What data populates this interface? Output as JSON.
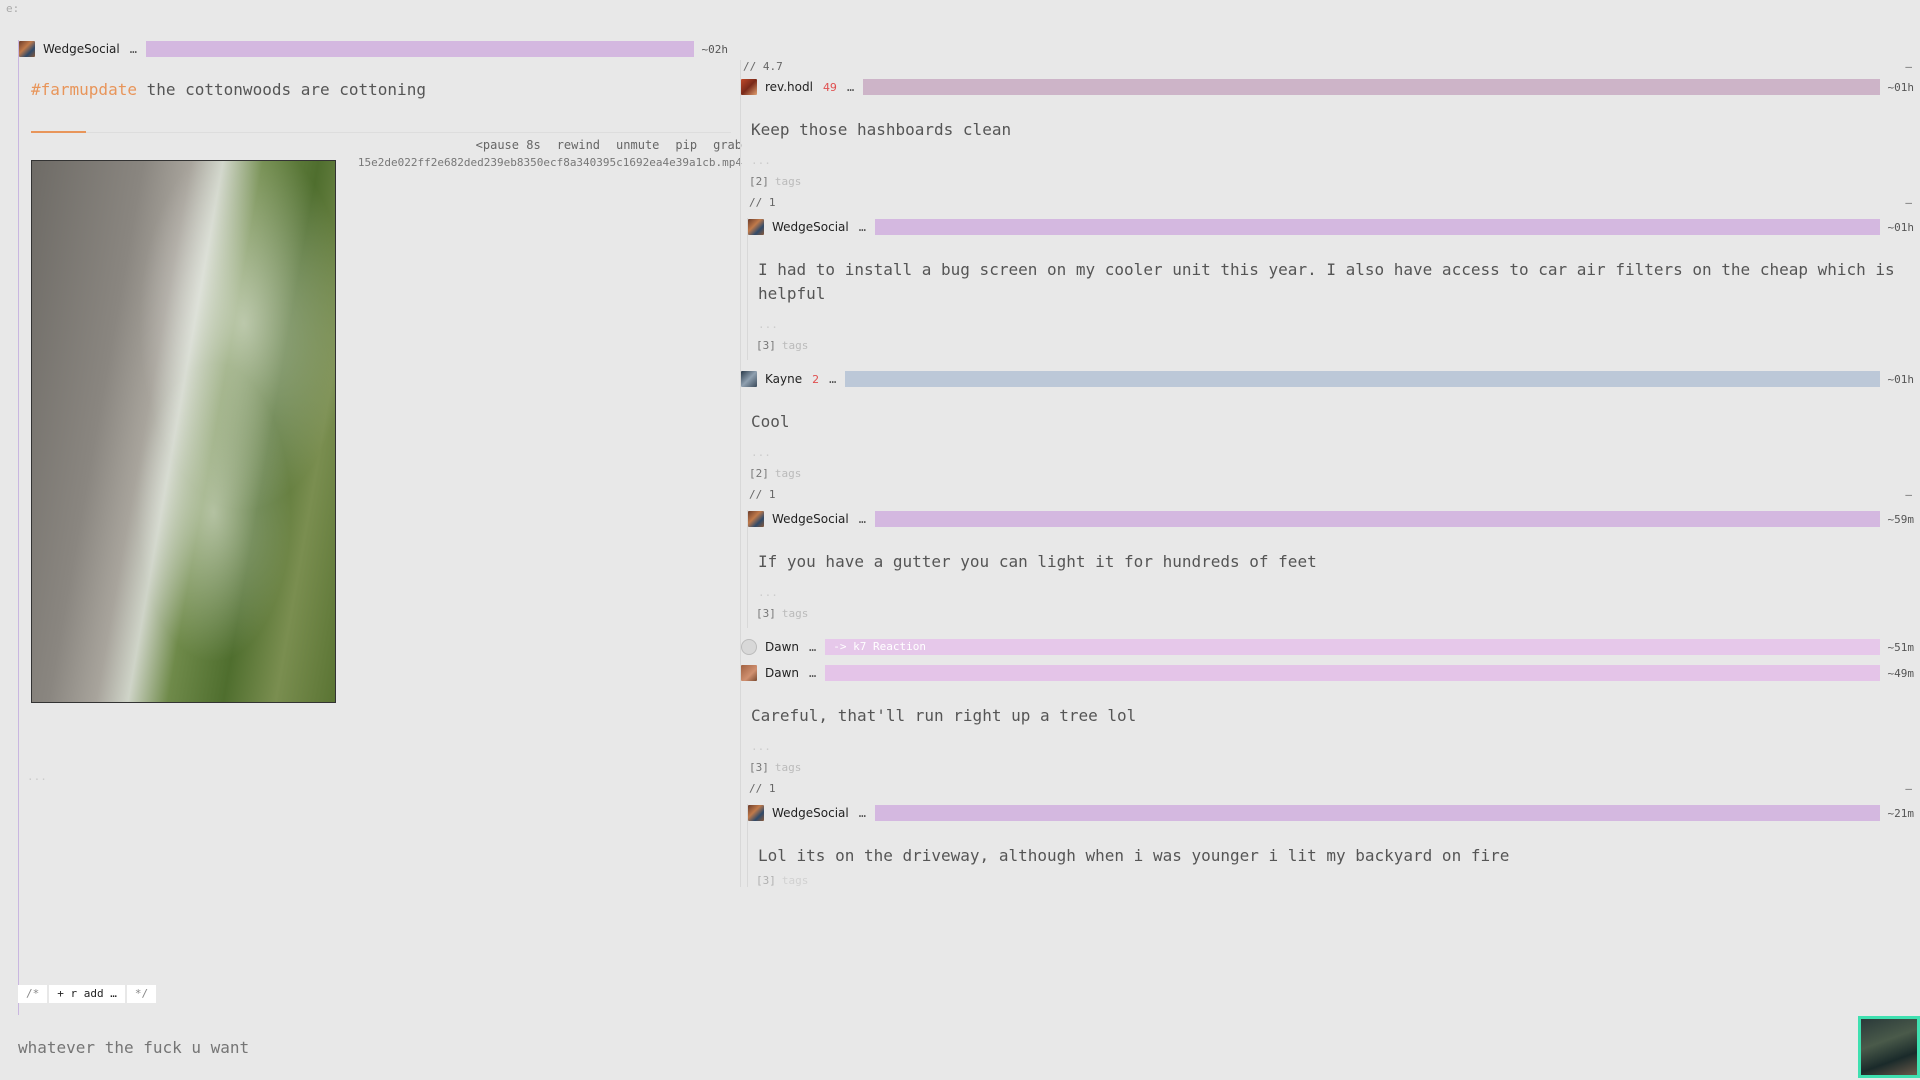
{
  "corner_label": "e:",
  "left_post": {
    "author": "WedgeSocial",
    "more": "…",
    "time": "~02h",
    "hashtag": "#farmupdate",
    "title_rest": " the cottonwoods are cottoning",
    "controls": [
      "<pause 8s",
      "rewind",
      "unmute",
      "pip",
      "grab"
    ],
    "filename": "15e2de022ff2e682ded239eb8350ecf8a340395c1692ea4e39a1cb.mp4",
    "dots": "..."
  },
  "composer": {
    "open": "/*",
    "add": "+ r add …",
    "close": "*/",
    "placeholder": "whatever the fuck u want"
  },
  "thread": {
    "top_meta": {
      "left": "// 4.7",
      "right": "–"
    },
    "posts": [
      {
        "author": "rev.hodl",
        "count": "49",
        "more": "…",
        "time": "~01h",
        "body": "Keep those hashboards clean",
        "dots": "...",
        "tags_count": "[2]",
        "tags_word": "tags",
        "meta": {
          "left": "// 1",
          "right": "–"
        },
        "reply": {
          "author": "WedgeSocial",
          "more": "…",
          "time": "~01h",
          "body": "I had to install a bug screen on my cooler unit this year. I also have access to car air filters on the cheap which is helpful",
          "dots": "...",
          "tags_count": "[3]",
          "tags_word": "tags"
        }
      },
      {
        "author": "Kayne",
        "count": "2",
        "more": "…",
        "time": "~01h",
        "body": "Cool",
        "dots": "...",
        "tags_count": "[2]",
        "tags_word": "tags",
        "meta": {
          "left": "// 1",
          "right": "–"
        },
        "reply": {
          "author": "WedgeSocial",
          "more": "…",
          "time": "~59m",
          "body": "If you have a gutter you can light it for hundreds of feet",
          "dots": "...",
          "tags_count": "[3]",
          "tags_word": "tags"
        }
      }
    ],
    "reaction": {
      "author": "Dawn",
      "more": "…",
      "label": "-> k7 Reaction",
      "time": "~51m"
    },
    "dawn_post": {
      "author": "Dawn",
      "more": "…",
      "time": "~49m",
      "body": "Careful, that'll run right up a tree lol",
      "dots": "...",
      "tags_count": "[3]",
      "tags_word": "tags",
      "meta": {
        "left": "// 1",
        "right": "–"
      },
      "reply": {
        "author": "WedgeSocial",
        "more": "…",
        "time": "~21m",
        "body": "Lol its on the driveway, although when i was younger i lit my backyard on fire",
        "tags_count": "[3]",
        "tags_word": "tags"
      }
    }
  },
  "colors": {
    "accent_orange": "#e8955a",
    "bar_purple": "#d4b8e0",
    "bar_mauve": "#cdb4c8",
    "bar_blue": "#bcc8d8",
    "bar_pink": "#e4c4e8",
    "highlight_teal": "#3fe0b0"
  }
}
